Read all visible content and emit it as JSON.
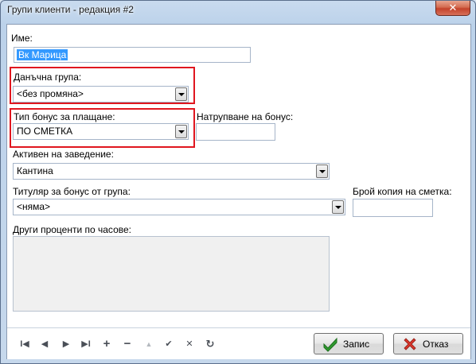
{
  "window": {
    "title": "Групи клиенти - редакция #2",
    "close_glyph": "✕"
  },
  "form": {
    "name_label": "Име:",
    "name_value": "Вк Марица",
    "tax_group_label": "Данъчна група:",
    "tax_group_value": "<без промяна>",
    "bonus_type_label": "Тип бонус за плащане:",
    "bonus_type_value": "ПО СМЕТКА",
    "bonus_accum_label": "Натрупване на бонус:",
    "bonus_accum_value": "",
    "active_venue_label": "Активен на заведение:",
    "active_venue_value": "Кантина",
    "group_bonus_holder_label": "Титуляр за бонус от група:",
    "group_bonus_holder_value": "<няма>",
    "receipt_copies_label": "Брой копия на сметка:",
    "receipt_copies_value": "",
    "hourly_percents_label": "Други проценти по часове:"
  },
  "nav": {
    "first": "I◀",
    "prev": "◀",
    "next": "▶",
    "last": "▶I",
    "add": "+",
    "delete": "−",
    "edit": "▲",
    "post": "✔",
    "cancel": "✕",
    "refresh": "↻"
  },
  "buttons": {
    "save_label": "Запис",
    "cancel_label": "Отказ"
  },
  "colors": {
    "highlight": "#e0161f",
    "selection": "#3399ff",
    "save_icon": "#2f9b2f",
    "cancel_icon": "#d9362b"
  }
}
